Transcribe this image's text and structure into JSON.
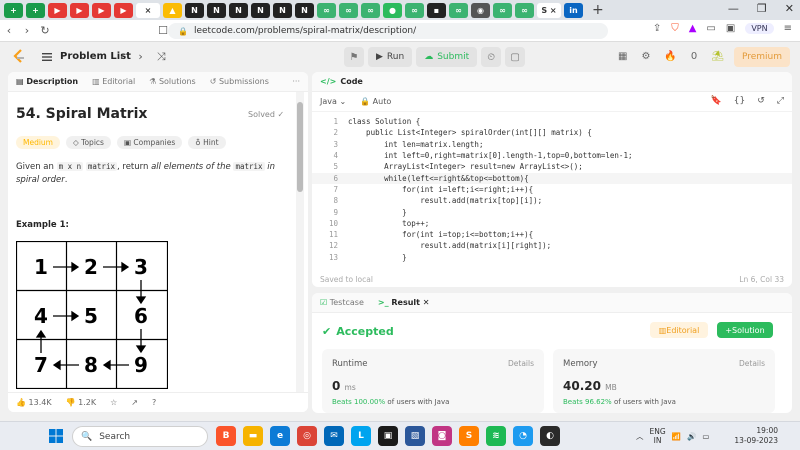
{
  "browser": {
    "tabs": [
      "+",
      "+",
      "N",
      "N",
      "N",
      "N",
      "N",
      "N",
      "N",
      "N"
    ],
    "url": "leetcode.com/problems/spiral-matrix/description/",
    "vpn_label": "VPN"
  },
  "header": {
    "problem_list_label": "Problem List",
    "run_label": "Run",
    "submit_label": "Submit",
    "streak_count": "0",
    "premium_label": "Premium"
  },
  "left_panel": {
    "tabs": [
      "Description",
      "Editorial",
      "Solutions",
      "Submissions"
    ],
    "title": "54. Spiral Matrix",
    "status": "Solved",
    "tags": [
      "Medium",
      "Topics",
      "Companies",
      "Hint"
    ],
    "desc_given": "Given an ",
    "desc_m_x_n": "m x n",
    "desc_matrix": "matrix",
    "desc_return": ", return ",
    "desc_all": "all elements of the ",
    "desc_matrix2": "matrix",
    "desc_spiral": " in spiral order",
    "desc_end": ".",
    "example_label": "Example 1:",
    "matrix_values": [
      "1",
      "2",
      "3",
      "4",
      "5",
      "6",
      "7",
      "8",
      "9"
    ],
    "likes": "13.4K",
    "dislikes": "1.2K"
  },
  "code_panel": {
    "title": "Code",
    "language": "Java",
    "mode": "Auto",
    "lines": [
      {
        "n": "1",
        "t": "class Solution {"
      },
      {
        "n": "2",
        "t": "    public List<Integer> spiralOrder(int[][] matrix) {"
      },
      {
        "n": "3",
        "t": "        int len=matrix.length;"
      },
      {
        "n": "4",
        "t": "        int left=0,right=matrix[0].length-1,top=0,bottom=len-1;"
      },
      {
        "n": "5",
        "t": "        ArrayList<Integer> result=new ArrayList<>();"
      },
      {
        "n": "6",
        "t": "        while(left<=right&&top<=bottom){"
      },
      {
        "n": "7",
        "t": "            for(int i=left;i<=right;i++){"
      },
      {
        "n": "8",
        "t": "                result.add(matrix[top][i]);"
      },
      {
        "n": "9",
        "t": "            }"
      },
      {
        "n": "10",
        "t": "            top++;"
      },
      {
        "n": "11",
        "t": "            for(int i=top;i<=bottom;i++){"
      },
      {
        "n": "12",
        "t": "                result.add(matrix[i][right]);"
      },
      {
        "n": "13",
        "t": "            }"
      }
    ],
    "saved_status": "Saved to local",
    "cursor_pos": "Ln 6, Col 33"
  },
  "result_panel": {
    "tabs": [
      "Testcase",
      "Result"
    ],
    "status": "Accepted",
    "editorial_label": "Editorial",
    "solution_label": "Solution",
    "runtime": {
      "label": "Runtime",
      "details": "Details",
      "value": "0",
      "unit": "ms",
      "beats": "Beats 100.00%",
      "suffix": "of users with Java"
    },
    "memory": {
      "label": "Memory",
      "details": "Details",
      "value": "40.20",
      "unit": "MB",
      "beats": "Beats 96.62%",
      "suffix": "of users with Java"
    }
  },
  "taskbar": {
    "search_placeholder": "Search",
    "language": "ENG",
    "region": "IN",
    "time": "19:00",
    "date": "13-09-2023"
  },
  "colors": {
    "accent_green": "#2cbb5d",
    "medium_yellow": "#ffb800",
    "premium_orange": "#e39b3b"
  }
}
